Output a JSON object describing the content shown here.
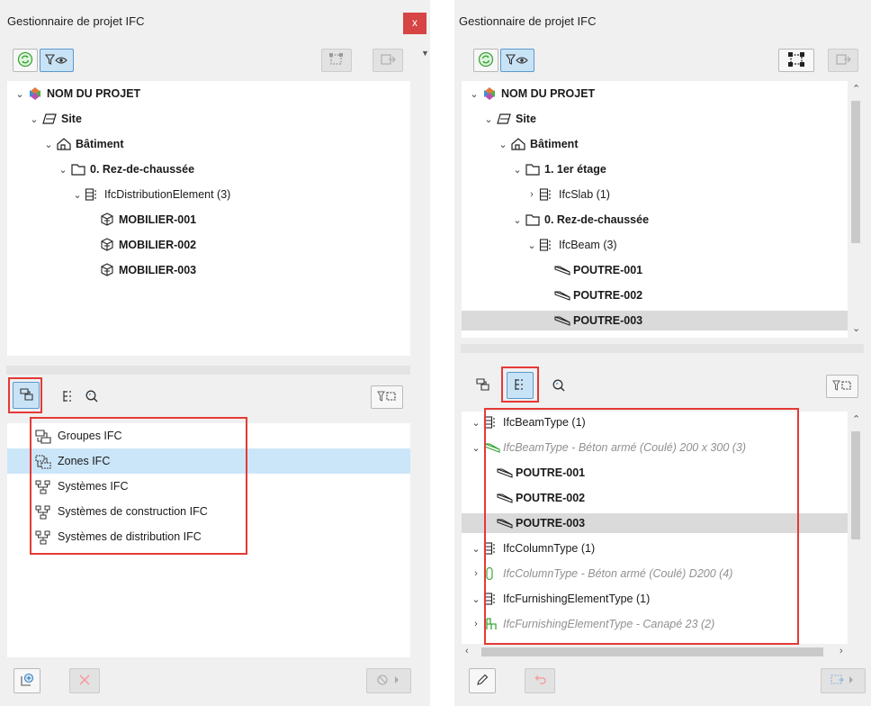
{
  "left": {
    "title": "Gestionnaire de projet IFC",
    "close_glyph": "x",
    "tree": [
      {
        "label": "NOM DU PROJET",
        "bold": true,
        "chev": "⌄",
        "icon": "project-icon"
      },
      {
        "label": "Site",
        "bold": true,
        "chev": "⌄",
        "icon": "site-icon"
      },
      {
        "label": "Bâtiment",
        "bold": true,
        "chev": "⌄",
        "icon": "building-icon"
      },
      {
        "label": "0. Rez-de-chaussée",
        "bold": true,
        "chev": "⌄",
        "icon": "storey-icon"
      },
      {
        "label": "IfcDistributionElement (3)",
        "bold": false,
        "chev": "⌄",
        "icon": "type-tree-icon"
      },
      {
        "label": "MOBILIER-001",
        "bold": true,
        "chev": "",
        "icon": "furniture-icon"
      },
      {
        "label": "MOBILIER-002",
        "bold": true,
        "chev": "",
        "icon": "furniture-icon"
      },
      {
        "label": "MOBILIER-003",
        "bold": true,
        "chev": "",
        "icon": "furniture-icon"
      }
    ],
    "groups": [
      {
        "label": "Groupes IFC",
        "icon": "group-icon"
      },
      {
        "label": "Zones IFC",
        "icon": "zone-icon"
      },
      {
        "label": "Systèmes IFC",
        "icon": "system-icon"
      },
      {
        "label": "Systèmes de construction IFC",
        "icon": "system-icon"
      },
      {
        "label": "Systèmes de distribution IFC",
        "icon": "system-icon"
      }
    ],
    "highlighted_group": "Zones IFC"
  },
  "right": {
    "title": "Gestionnaire de projet IFC",
    "tree": [
      {
        "label": "NOM DU PROJET",
        "bold": true,
        "chev": "⌄",
        "icon": "project-icon"
      },
      {
        "label": "Site",
        "bold": true,
        "chev": "⌄",
        "icon": "site-icon"
      },
      {
        "label": "Bâtiment",
        "bold": true,
        "chev": "⌄",
        "icon": "building-icon"
      },
      {
        "label": "1. 1er étage",
        "bold": true,
        "chev": "⌄",
        "icon": "storey-icon"
      },
      {
        "label": "IfcSlab (1)",
        "bold": false,
        "chev": "›",
        "icon": "type-tree-icon"
      },
      {
        "label": "0. Rez-de-chaussée",
        "bold": true,
        "chev": "⌄",
        "icon": "storey-icon"
      },
      {
        "label": "IfcBeam (3)",
        "bold": false,
        "chev": "⌄",
        "icon": "type-tree-icon"
      },
      {
        "label": "POUTRE-001",
        "bold": true,
        "chev": "",
        "icon": "beam-icon"
      },
      {
        "label": "POUTRE-002",
        "bold": true,
        "chev": "",
        "icon": "beam-icon"
      },
      {
        "label": "POUTRE-003",
        "bold": true,
        "chev": "",
        "icon": "beam-icon",
        "selected": true
      }
    ],
    "types": [
      {
        "label": "IfcBeamType (1)",
        "bold": false,
        "italic": false,
        "chev": "⌄",
        "icon": "type-tree-icon"
      },
      {
        "label": "IfcBeamType - Béton armé (Coulé) 200 x 300 (3)",
        "bold": false,
        "italic": true,
        "chev": "⌄",
        "icon": "beam-type-icon"
      },
      {
        "label": "POUTRE-001",
        "bold": true,
        "italic": false,
        "chev": "",
        "icon": "beam-icon"
      },
      {
        "label": "POUTRE-002",
        "bold": true,
        "italic": false,
        "chev": "",
        "icon": "beam-icon"
      },
      {
        "label": "POUTRE-003",
        "bold": true,
        "italic": false,
        "chev": "",
        "icon": "beam-icon",
        "selected": true
      },
      {
        "label": "IfcColumnType (1)",
        "bold": false,
        "italic": false,
        "chev": "⌄",
        "icon": "type-tree-icon"
      },
      {
        "label": "IfcColumnType - Béton armé (Coulé) D200 (4)",
        "bold": false,
        "italic": true,
        "chev": "›",
        "icon": "column-type-icon"
      },
      {
        "label": "IfcFurnishingElementType (1)",
        "bold": false,
        "italic": false,
        "chev": "⌄",
        "icon": "type-tree-icon"
      },
      {
        "label": "IfcFurnishingElementType - Canapé 23 (2)",
        "bold": false,
        "italic": true,
        "chev": "›",
        "icon": "furnishing-type-icon"
      }
    ]
  },
  "colors": {
    "panel": "#f0f0f0",
    "highlight": "#cce6f9",
    "selection": "#dadada",
    "annotation": "#e53935",
    "close": "#d64444"
  }
}
